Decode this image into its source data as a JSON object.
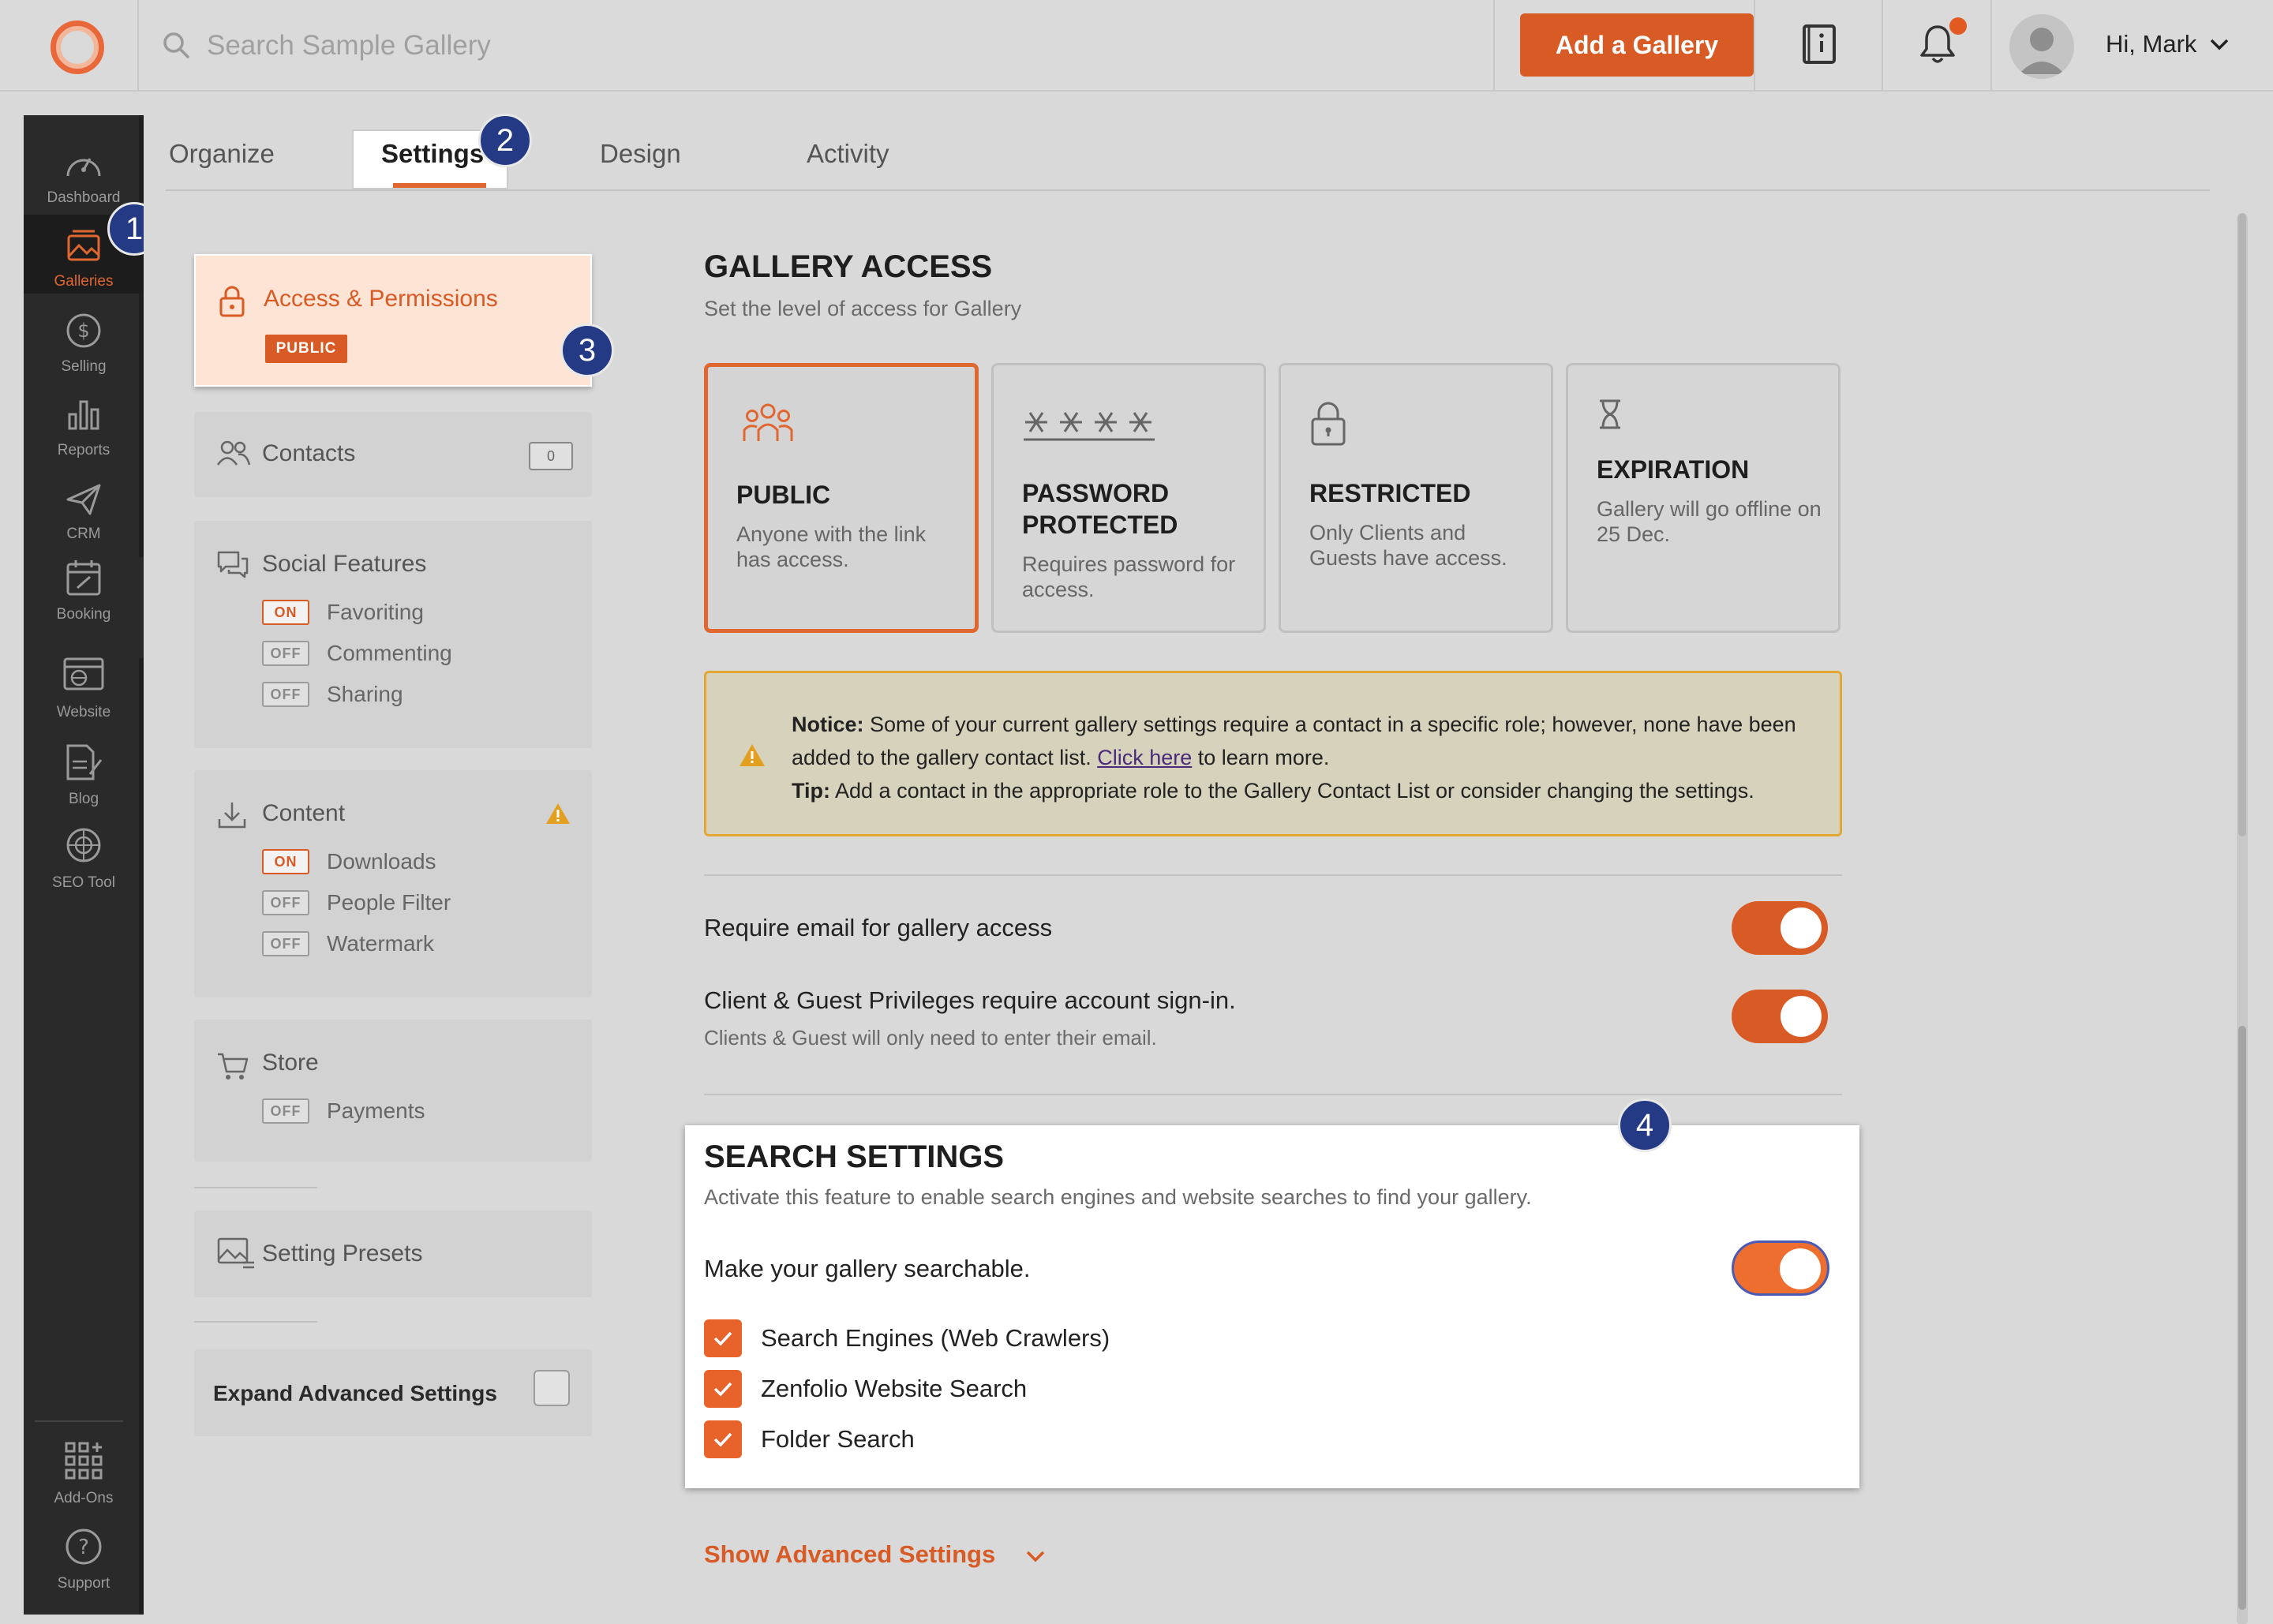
{
  "topbar": {
    "search_placeholder": "Search Sample Gallery",
    "add_gallery_label": "Add a Gallery",
    "greeting": "Hi, Mark",
    "accent_color": "#d85a24"
  },
  "leftnav": {
    "items": [
      {
        "label": "Dashboard",
        "icon": "gauge-icon"
      },
      {
        "label": "Galleries",
        "icon": "image-icon",
        "active": true
      },
      {
        "label": "Selling",
        "icon": "dollar-icon"
      },
      {
        "label": "Reports",
        "icon": "bar-chart-icon"
      },
      {
        "label": "CRM",
        "icon": "paper-plane-icon"
      },
      {
        "label": "Booking",
        "icon": "calendar-icon"
      },
      {
        "label": "Website",
        "icon": "website-icon"
      },
      {
        "label": "Blog",
        "icon": "blog-icon"
      },
      {
        "label": "SEO Tool",
        "icon": "seo-globe-icon"
      }
    ],
    "bottom_items": [
      {
        "label": "Add-Ons",
        "icon": "add-ons-grid-icon"
      },
      {
        "label": "Support",
        "icon": "help-icon"
      }
    ]
  },
  "tabs": [
    {
      "label": "Organize"
    },
    {
      "label": "Settings",
      "active": true
    },
    {
      "label": "Design"
    },
    {
      "label": "Activity"
    }
  ],
  "callouts": [
    "1",
    "2",
    "3",
    "4"
  ],
  "menu": {
    "access": {
      "title": "Access & Permissions",
      "tag": "PUBLIC"
    },
    "contacts": {
      "title": "Contacts",
      "count": "0"
    },
    "social": {
      "title": "Social Features",
      "items": [
        {
          "state": "ON",
          "label": "Favoriting"
        },
        {
          "state": "OFF",
          "label": "Commenting"
        },
        {
          "state": "OFF",
          "label": "Sharing"
        }
      ]
    },
    "content": {
      "title": "Content",
      "items": [
        {
          "state": "ON",
          "label": "Downloads"
        },
        {
          "state": "OFF",
          "label": "People Filter"
        },
        {
          "state": "OFF",
          "label": "Watermark"
        }
      ]
    },
    "store": {
      "title": "Store",
      "items": [
        {
          "state": "OFF",
          "label": "Payments"
        }
      ]
    },
    "presets": {
      "title": "Setting Presets"
    },
    "advanced": {
      "title": "Expand Advanced Settings",
      "checked": false
    }
  },
  "gallery_access": {
    "title": "GALLERY ACCESS",
    "subtitle": "Set the level of access for Gallery",
    "options": [
      {
        "title": "PUBLIC",
        "desc": "Anyone with the link has access.",
        "icon": "people-group-icon",
        "selected": true
      },
      {
        "title": "PASSWORD PROTECTED",
        "title_line1": "PASSWORD",
        "title_line2": "PROTECTED",
        "desc": "Requires password for access.",
        "icon": "password-asterisks-icon"
      },
      {
        "title": "RESTRICTED",
        "desc": "Only Clients and Guests have access.",
        "icon": "lock-icon"
      },
      {
        "title": "EXPIRATION",
        "desc": "Gallery will go offline on 25 Dec.",
        "icon": "hourglass-icon"
      }
    ],
    "notice": {
      "notice_label": "Notice:",
      "notice_text": " Some of your current gallery settings require a contact in a specific role; however, none have been added to the gallery contact list. ",
      "link_text": "Click here",
      "after_link": " to learn more.",
      "tip_label": "Tip:",
      "tip_text": " Add a contact in the appropriate role to the Gallery Contact List or consider changing the settings."
    },
    "require_email": {
      "label": "Require email for gallery access",
      "on": true
    },
    "client_signin": {
      "label": "Client & Guest Privileges require account sign-in.",
      "sub": "Clients & Guest will only need to enter their email.",
      "on": true
    }
  },
  "search_settings": {
    "title": "SEARCH SETTINGS",
    "subtitle": "Activate this feature to enable search engines and website searches to find your gallery.",
    "make_searchable": "Make your gallery searchable.",
    "on": true,
    "options": [
      {
        "label": "Search Engines (Web Crawlers)",
        "checked": true
      },
      {
        "label": "Zenfolio Website Search",
        "checked": true
      },
      {
        "label": "Folder Search",
        "checked": true
      }
    ]
  },
  "show_advanced": "Show Advanced Settings"
}
